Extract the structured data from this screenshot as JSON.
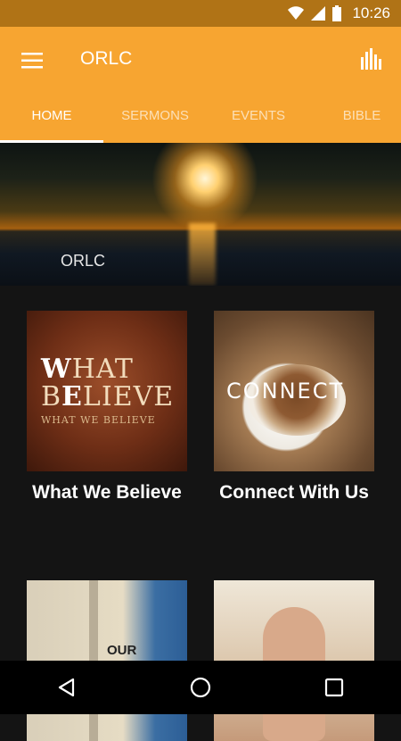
{
  "status_bar": {
    "time": "10:26"
  },
  "app_bar": {
    "title": "ORLC",
    "menu_icon": "hamburger-menu-icon",
    "chart_icon": "bar-chart-icon"
  },
  "tabs": [
    {
      "label": "HOME",
      "active": true
    },
    {
      "label": "SERMONS",
      "active": false
    },
    {
      "label": "EVENTS",
      "active": false
    },
    {
      "label": "BIBLE",
      "active": false
    }
  ],
  "hero": {
    "label": "ORLC"
  },
  "cards": [
    {
      "title": "What We Believe",
      "image_text": {
        "line1_big": "W",
        "line1_rest": "HAT",
        "line2_start": "B",
        "line2_big": "E",
        "line2_rest": "LIEVE",
        "line3": "WHAT WE BELIEVE"
      }
    },
    {
      "title": "Connect With Us",
      "image_text": "CONNECT"
    },
    {
      "title": "",
      "image_text": "OUR"
    },
    {
      "title": ""
    }
  ],
  "colors": {
    "status_bar": "#b07316",
    "app_bar": "#f7a531",
    "background": "#141414",
    "nav_bar": "#000000"
  },
  "nav": {
    "back_icon": "back-triangle-icon",
    "home_icon": "home-circle-icon",
    "recents_icon": "recents-square-icon"
  }
}
